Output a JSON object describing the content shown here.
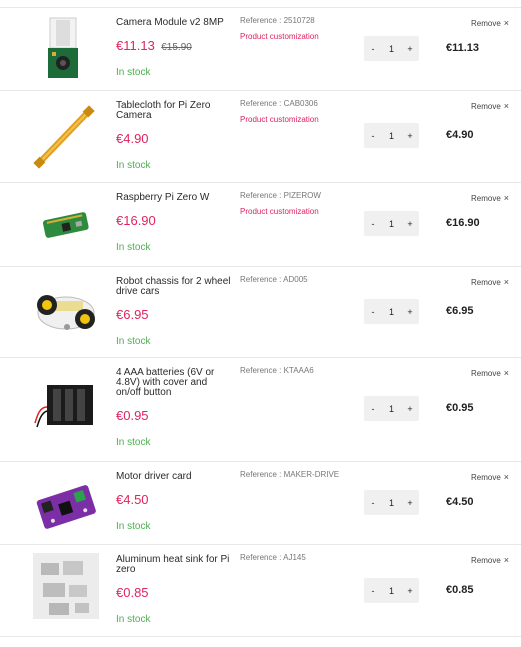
{
  "cart": {
    "remove_label": "Remove",
    "remove_icon_glyph": "×",
    "minus_glyph": "-",
    "plus_glyph": "+",
    "colors": {
      "price": "#e0245e",
      "in_stock": "#4caf50",
      "stepper_bg": "#f0f0f0",
      "divider": "#e8e8e8"
    },
    "items": [
      {
        "name": "Camera Module v2 8MP",
        "price": "€11.13",
        "old_price": "€15.90",
        "stock": "In stock",
        "reference": "Reference : 2510728",
        "customization": "Product customization",
        "quantity": "1",
        "total": "€11.13",
        "image_icon": "camera-module-image"
      },
      {
        "name": "Tablecloth for Pi Zero Camera",
        "price": "€4.90",
        "old_price": "",
        "stock": "In stock",
        "reference": "Reference : CAB0306",
        "customization": "Product customization",
        "quantity": "1",
        "total": "€4.90",
        "image_icon": "ribbon-cable-image"
      },
      {
        "name": "Raspberry Pi Zero W",
        "price": "€16.90",
        "old_price": "",
        "stock": "In stock",
        "reference": "Reference : PIZEROW",
        "customization": "Product customization",
        "quantity": "1",
        "total": "€16.90",
        "image_icon": "pi-zero-board-image"
      },
      {
        "name": "Robot chassis for 2 wheel drive cars",
        "price": "€6.95",
        "old_price": "",
        "stock": "In stock",
        "reference": "Reference : AD005",
        "customization": "",
        "quantity": "1",
        "total": "€6.95",
        "image_icon": "robot-chassis-image"
      },
      {
        "name": "4 AAA batteries (6V or 4.8V) with cover and on/off button",
        "price": "€0.95",
        "old_price": "",
        "stock": "In stock",
        "reference": "Reference : KTAAA6",
        "customization": "",
        "quantity": "1",
        "total": "€0.95",
        "image_icon": "battery-holder-image"
      },
      {
        "name": "Motor driver card",
        "price": "€4.50",
        "old_price": "",
        "stock": "In stock",
        "reference": "Reference : MAKER-DRIVE",
        "customization": "",
        "quantity": "1",
        "total": "€4.50",
        "image_icon": "motor-driver-image"
      },
      {
        "name": "Aluminum heat sink for Pi zero",
        "price": "€0.85",
        "old_price": "",
        "stock": "In stock",
        "reference": "Reference : AJ145",
        "customization": "",
        "quantity": "1",
        "total": "€0.85",
        "image_icon": "heat-sink-image"
      }
    ]
  }
}
